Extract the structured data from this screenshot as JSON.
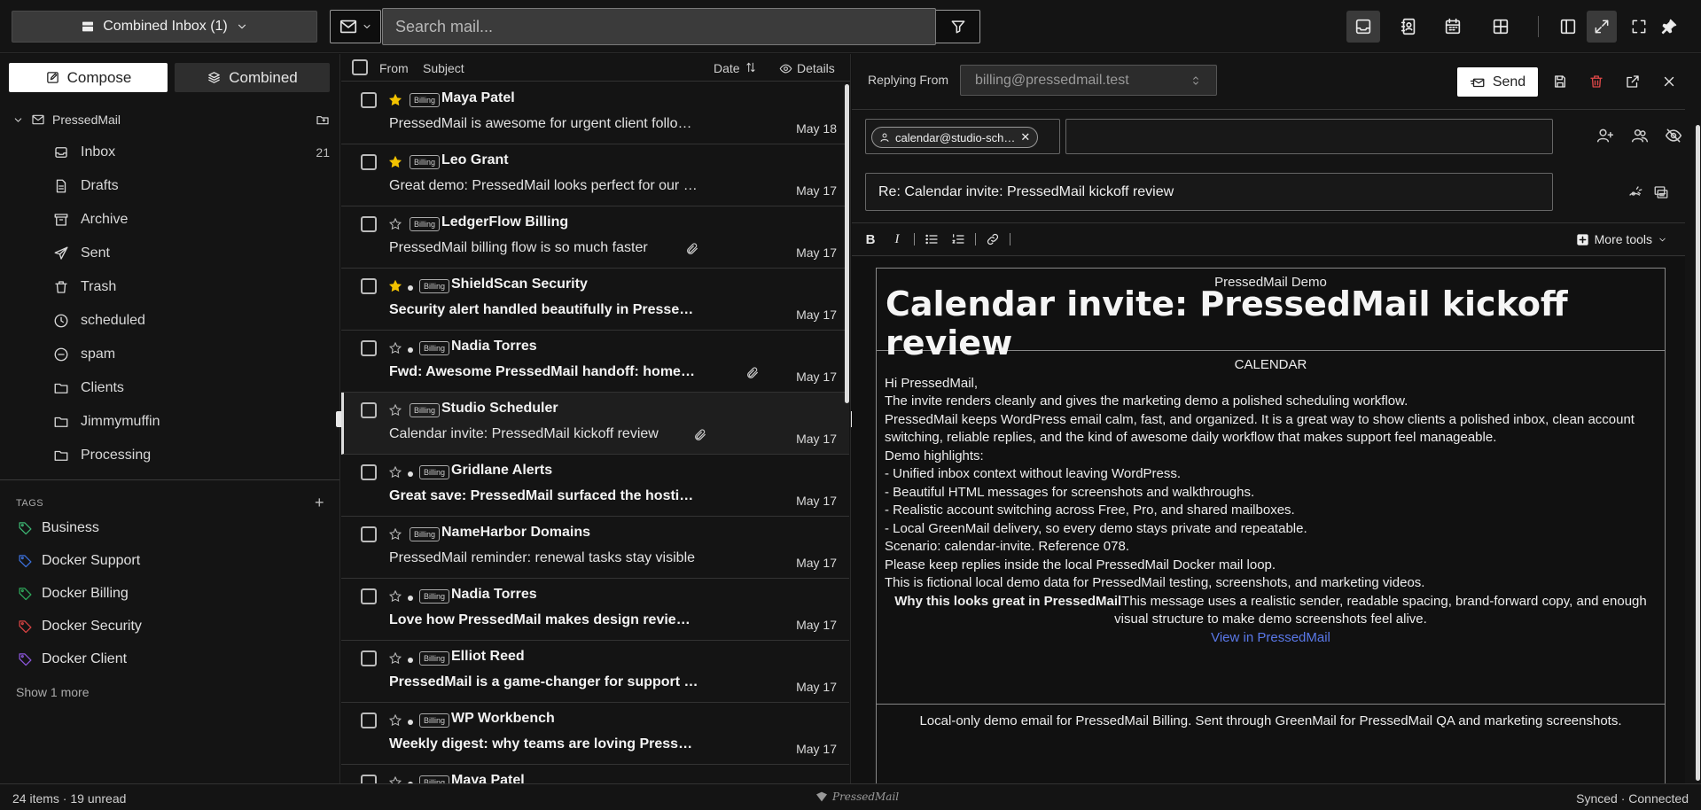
{
  "topbar": {
    "inbox_selector": "Combined Inbox (1)",
    "search_placeholder": "Search mail..."
  },
  "sidebar": {
    "compose_label": "Compose",
    "combined_label": "Combined",
    "account_name": "PressedMail",
    "folders": [
      {
        "label": "Inbox",
        "icon": "inbox-icon",
        "count": "21"
      },
      {
        "label": "Drafts",
        "icon": "drafts-icon",
        "count": ""
      },
      {
        "label": "Archive",
        "icon": "archive-icon",
        "count": ""
      },
      {
        "label": "Sent",
        "icon": "send-icon",
        "count": ""
      },
      {
        "label": "Trash",
        "icon": "trash-icon",
        "count": ""
      },
      {
        "label": "scheduled",
        "icon": "clock-icon",
        "count": ""
      },
      {
        "label": "spam",
        "icon": "spam-icon",
        "count": ""
      },
      {
        "label": "Clients",
        "icon": "folder-icon",
        "count": ""
      },
      {
        "label": "Jimmymuffin",
        "icon": "folder-icon",
        "count": ""
      },
      {
        "label": "Processing",
        "icon": "folder-icon",
        "count": ""
      }
    ],
    "tags_heading": "TAGS",
    "tags": [
      {
        "label": "Business",
        "color": "#3cb371"
      },
      {
        "label": "Docker Support",
        "color": "#3b6fd8"
      },
      {
        "label": "Docker Billing",
        "color": "#2ea85a"
      },
      {
        "label": "Docker Security",
        "color": "#d84343"
      },
      {
        "label": "Docker Client",
        "color": "#8a55d8"
      }
    ],
    "show_more": "Show 1 more"
  },
  "list": {
    "header": {
      "from": "From",
      "subject": "Subject",
      "date": "Date",
      "details": "Details"
    },
    "badge_label": "Billing",
    "messages": [
      {
        "from": "Maya Patel",
        "subject": "PressedMail is awesome for urgent client follow-up",
        "date": "May 18",
        "starred": true,
        "unread": false,
        "attachment": false
      },
      {
        "from": "Leo Grant",
        "subject": "Great demo: PressedMail looks perfect for our age…",
        "date": "May 17",
        "starred": true,
        "unread": false,
        "attachment": false
      },
      {
        "from": "LedgerFlow Billing",
        "subject": "PressedMail billing flow is so much faster",
        "date": "May 17",
        "starred": false,
        "unread": false,
        "attachment": true
      },
      {
        "from": "ShieldScan Security",
        "subject": "Security alert handled beautifully in PressedMail",
        "date": "May 17",
        "starred": true,
        "unread": true,
        "attachment": false
      },
      {
        "from": "Nadia Torres",
        "subject": "Fwd: Awesome PressedMail handoff: homepa…",
        "date": "May 17",
        "starred": false,
        "unread": true,
        "attachment": true
      },
      {
        "from": "Studio Scheduler",
        "subject": "Calendar invite: PressedMail kickoff review",
        "date": "May 17",
        "starred": false,
        "unread": false,
        "attachment": true,
        "selected": true
      },
      {
        "from": "Gridlane Alerts",
        "subject": "Great save: PressedMail surfaced the hosting ale…",
        "date": "May 17",
        "starred": false,
        "unread": true,
        "attachment": false
      },
      {
        "from": "NameHarbor Domains",
        "subject": "PressedMail reminder: renewal tasks stay visible",
        "date": "May 17",
        "starred": false,
        "unread": false,
        "attachment": false
      },
      {
        "from": "Nadia Torres",
        "subject": "Love how PressedMail makes design review feel …",
        "date": "May 17",
        "starred": false,
        "unread": true,
        "attachment": false
      },
      {
        "from": "Elliot Reed",
        "subject": "PressedMail is a game-changer for support escal…",
        "date": "May 17",
        "starred": false,
        "unread": true,
        "attachment": false
      },
      {
        "from": "WP Workbench",
        "subject": "Weekly digest: why teams are loving PressedMail",
        "date": "May 17",
        "starred": false,
        "unread": true,
        "attachment": false
      },
      {
        "from": "Maya Patel",
        "subject": "",
        "date": "",
        "starred": false,
        "unread": true,
        "attachment": false
      }
    ]
  },
  "compose": {
    "reply_from_label": "Replying From",
    "reply_from_value": "billing@pressedmail.test",
    "send_label": "Send",
    "recipient_chip": "calendar@studio-sch…",
    "subject": "Re: Calendar invite: PressedMail kickoff review",
    "toolbar": {
      "bold": "B",
      "italic": "I",
      "more_tools": "More tools"
    },
    "email": {
      "brand": "PressedMail Demo",
      "headline": "Calendar invite: PressedMail kickoff review",
      "section": "CALENDAR",
      "lines": [
        "Hi PressedMail,",
        "The invite renders cleanly and gives the marketing demo a polished scheduling workflow.",
        "PressedMail keeps WordPress email calm, fast, and organized. It is a great way to show clients a polished inbox, clean account switching, reliable replies, and the kind of awesome daily workflow that makes support feel manageable.",
        "Demo highlights:",
        "- Unified inbox context without leaving WordPress.",
        "- Beautiful HTML messages for screenshots and walkthroughs.",
        "- Realistic account switching across Free, Pro, and shared mailboxes.",
        "- Local GreenMail delivery, so every demo stays private and repeatable.",
        "Scenario: calendar-invite. Reference 078.",
        "Please keep replies inside the local PressedMail Docker mail loop.",
        "This is fictional local demo data for PressedMail testing, screenshots, and marketing videos."
      ],
      "why_bold": "Why this looks great in PressedMail",
      "why_text": "This message uses a realistic sender, readable spacing, brand-forward copy, and enough visual structure to make demo screenshots feel alive.",
      "link": "View in PressedMail",
      "footer": "Local-only demo email for PressedMail Billing. Sent through GreenMail for PressedMail QA and marketing screenshots."
    }
  },
  "status": {
    "left": "24 items · 19 unread",
    "logo": "PressedMail",
    "right": "Synced · Connected"
  }
}
